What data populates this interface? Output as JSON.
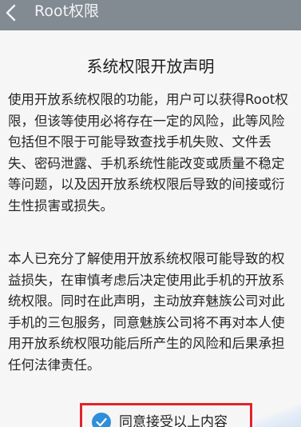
{
  "header": {
    "title": "Root权限"
  },
  "declaration": {
    "title": "系统权限开放声明",
    "paragraph1": [
      "使用开放系统权限的功能，用户可以获得Root权",
      "限，但该等使用必将存在一定的风险，此等风险",
      "包括但不限于可能导致查找手机失败、文件丢",
      "失、密码泄露、手机系统性能改变或质量不稳定",
      "等问题，以及因开放系统权限后导致的间接或衍",
      "生性损害或损失。"
    ],
    "paragraph2": [
      "本人已充分了解使用开放系统权限可能导致的权",
      "益损失，在审慎考虑后决定使用此手机的开放系",
      "统权限。同时在此声明，主动放弃魅族公司对此",
      "手机的三包服务，同意魅族公司将不再对本人使",
      "用开放系统权限功能后所产生的风险和后果承担",
      "任何法律责任。"
    ]
  },
  "agree": {
    "label": "同意接受以上内容",
    "checked": true,
    "accent_color": "#2f8fd8",
    "highlight_color": "#e0242c"
  },
  "icons": {
    "back": "chevron-left-icon",
    "check": "check-circle-icon"
  }
}
